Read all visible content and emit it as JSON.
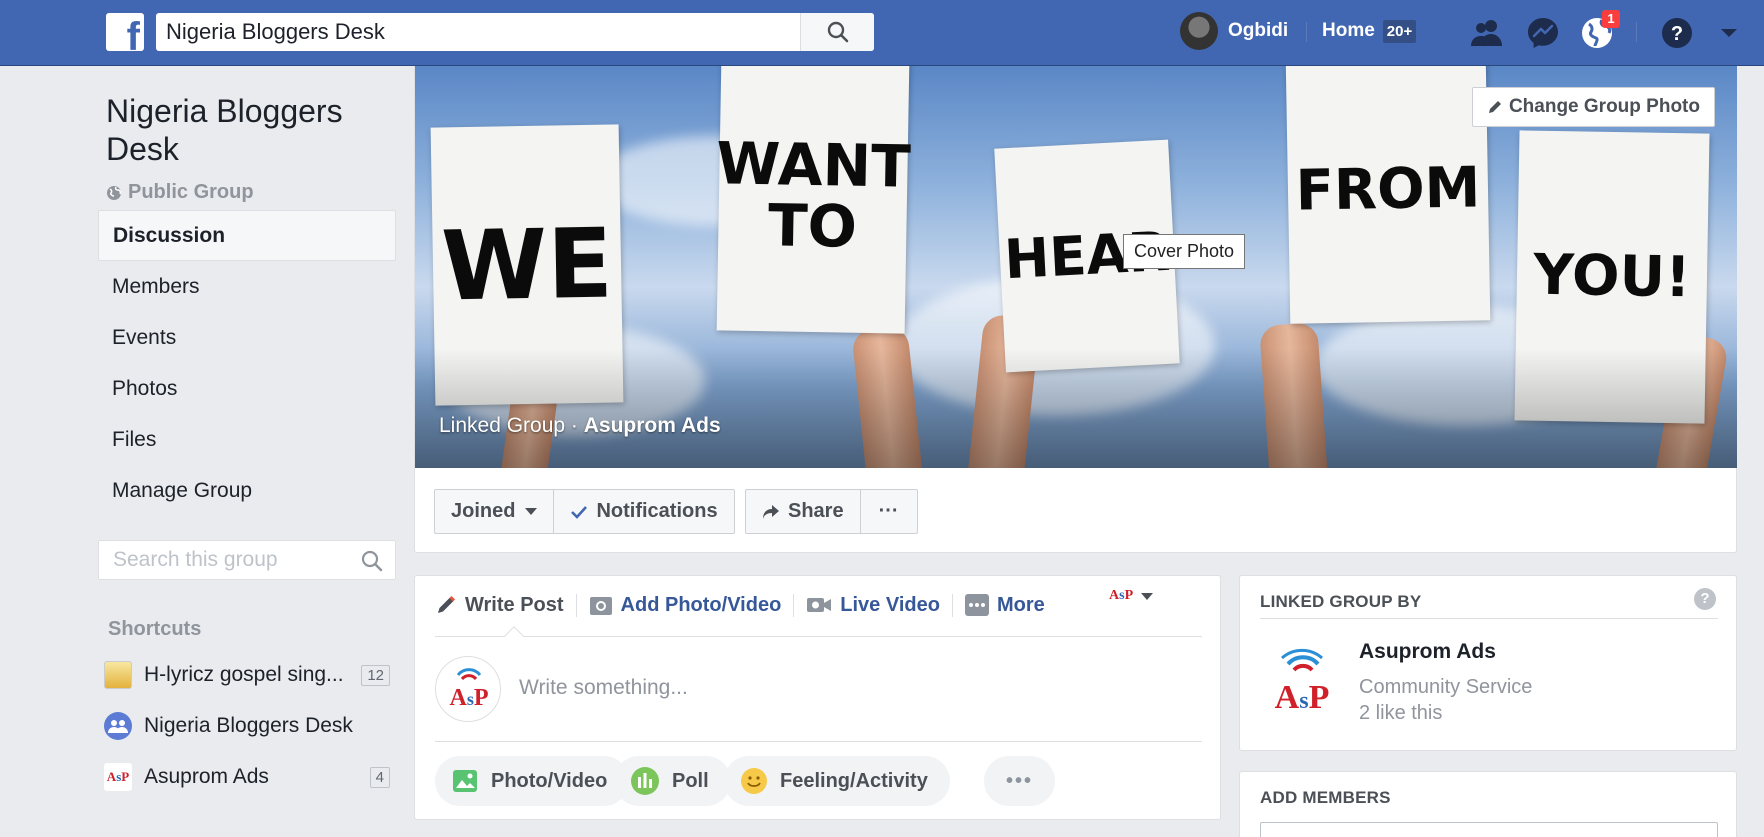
{
  "topbar": {
    "search_value": "Nigeria Bloggers Desk",
    "user_name": "Ogbidi",
    "home_label": "Home",
    "home_count": "20+",
    "notification_count": "1",
    "brand_color": "#4267b2",
    "icons": [
      "facebook-logo-icon",
      "search-icon",
      "friend-requests-icon",
      "messenger-icon",
      "globe-notifications-icon",
      "help-icon",
      "account-menu-caret-icon"
    ]
  },
  "sidebar": {
    "group_name": "Nigeria Bloggers Desk",
    "privacy": "Public Group",
    "nav": [
      {
        "label": "Discussion",
        "active": true
      },
      {
        "label": "Members"
      },
      {
        "label": "Events"
      },
      {
        "label": "Photos"
      },
      {
        "label": "Files"
      },
      {
        "label": "Manage Group"
      }
    ],
    "search_placeholder": "Search this group",
    "shortcuts_title": "Shortcuts",
    "shortcuts": [
      {
        "label": "H-lyricz gospel sing...",
        "count": "12"
      },
      {
        "label": "Nigeria Bloggers Desk",
        "count": ""
      },
      {
        "label": "Asuprom Ads",
        "count": "4"
      }
    ]
  },
  "cover": {
    "signs": [
      "WE",
      "WANT TO",
      "HEAR",
      "FROM",
      "YOU!"
    ],
    "linked_prefix": "Linked Group · ",
    "linked_name": "Asuprom Ads",
    "change_photo": "Change Group Photo",
    "tooltip": "Cover Photo"
  },
  "actions": {
    "joined": "Joined",
    "notifications": "Notifications",
    "share": "Share",
    "more": "···"
  },
  "composer": {
    "tabs": [
      "Write Post",
      "Add Photo/Video",
      "Live Video",
      "More"
    ],
    "placeholder": "Write something...",
    "pills": [
      "Photo/Video",
      "Poll",
      "Feeling/Activity",
      "•••"
    ]
  },
  "linked_card": {
    "title": "LINKED GROUP BY",
    "help": "?",
    "page_name": "Asuprom Ads",
    "category": "Community Service",
    "likes": "2 like this",
    "logo_text": "AsP"
  },
  "add_members": {
    "title": "ADD MEMBERS"
  }
}
